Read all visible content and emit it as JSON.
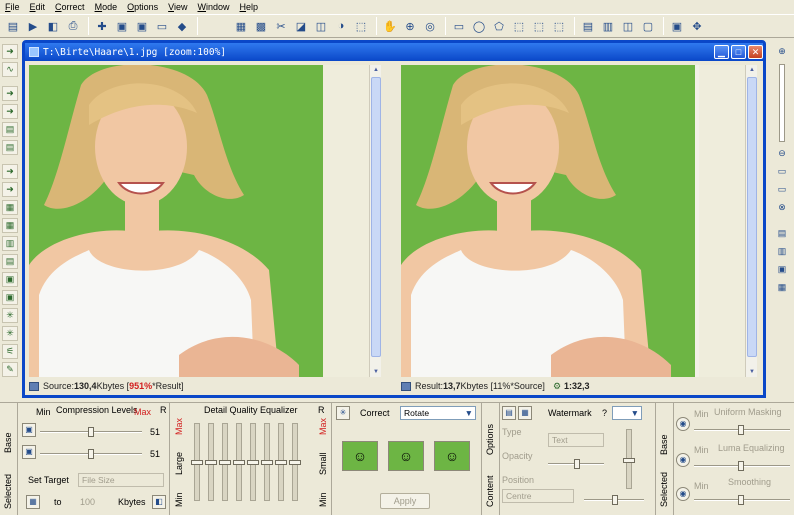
{
  "menu": [
    {
      "label": "File",
      "key": "F",
      "rest": "ile"
    },
    {
      "label": "Edit",
      "key": "E",
      "rest": "dit"
    },
    {
      "label": "Correct",
      "key": "C",
      "rest": "orrect"
    },
    {
      "label": "Mode",
      "key": "M",
      "rest": "ode"
    },
    {
      "label": "Options",
      "key": "O",
      "rest": "ptions"
    },
    {
      "label": "View",
      "key": "V",
      "rest": "iew"
    },
    {
      "label": "Window",
      "key": "W",
      "rest": "indow"
    },
    {
      "label": "Help",
      "key": "H",
      "rest": "elp"
    }
  ],
  "document": {
    "title": "T:\\Birte\\Haare\\1.jpg  [zoom:100%]",
    "source_status_prefix": "Source: ",
    "source_size": "130,4",
    "source_unit": " Kbytes  [",
    "source_percent": "951%",
    "source_suffix": "*Result]",
    "result_status_prefix": "Result: ",
    "result_size": "13,7",
    "result_unit": " Kbytes  [11%*Source]",
    "ratio": "1:32,3"
  },
  "panel": {
    "base_tab": "Base",
    "selected_tab": "Selected",
    "compression": {
      "title": "Compression Levels",
      "min": "Min",
      "max": "Max",
      "r": "R",
      "value1": "51",
      "value2": "51",
      "set_target": "Set Target",
      "target_field": "File Size",
      "to": "to",
      "target_value": "100",
      "unit": "Kbytes"
    },
    "equalizer": {
      "title": "Detail Quality Equalizer",
      "max_left": "Max",
      "large": "Large",
      "min_left": "Min",
      "r": "R",
      "max_right": "Max",
      "small": "Small",
      "min_right": "Min"
    },
    "correct": {
      "title": "Correct",
      "select_value": "Rotate",
      "apply": "Apply"
    },
    "watermark": {
      "options_tab": "Options",
      "content_tab": "Content",
      "title": "Watermark",
      "help": "?",
      "type_label": "Type",
      "type_value": "Text",
      "opacity_label": "Opacity",
      "position_label": "Position",
      "position_value": "Centre"
    },
    "masking": {
      "base_tab": "Base",
      "selected_tab": "Selected",
      "min1": "Min",
      "title1": "Uniform Masking",
      "min2": "Min",
      "title2": "Luma Equalizing",
      "min3": "Min",
      "title3": "Smoothing"
    }
  },
  "colors": {
    "window_frame": "#0a47c8",
    "image_background": "#6db544",
    "accent_red": "#d21d1d"
  }
}
